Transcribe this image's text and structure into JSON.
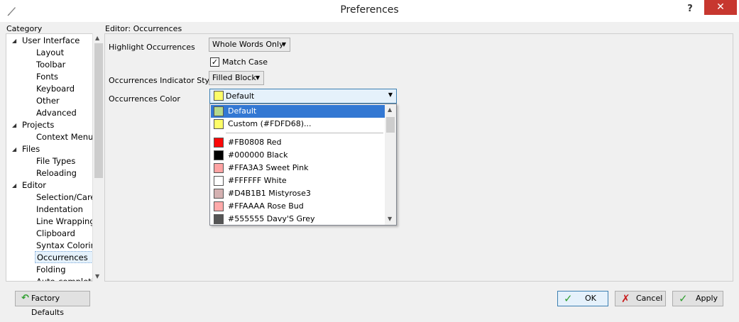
{
  "window": {
    "title": "Preferences",
    "help": "?",
    "close": "✕"
  },
  "sidebar": {
    "header": "Category",
    "items": [
      {
        "label": "User Interface",
        "expanded": true
      },
      {
        "label": "Layout"
      },
      {
        "label": "Toolbar"
      },
      {
        "label": "Fonts"
      },
      {
        "label": "Keyboard"
      },
      {
        "label": "Other"
      },
      {
        "label": "Advanced"
      },
      {
        "label": "Projects",
        "expanded": true
      },
      {
        "label": "Context Menu"
      },
      {
        "label": "Files",
        "expanded": true
      },
      {
        "label": "File Types"
      },
      {
        "label": "Reloading"
      },
      {
        "label": "Editor",
        "expanded": true
      },
      {
        "label": "Selection/Caret"
      },
      {
        "label": "Indentation"
      },
      {
        "label": "Line Wrapping"
      },
      {
        "label": "Clipboard"
      },
      {
        "label": "Syntax Coloring"
      },
      {
        "label": "Occurrences",
        "selected": true
      },
      {
        "label": "Folding"
      },
      {
        "label": "Auto-completion"
      }
    ]
  },
  "panel": {
    "title": "Editor: Occurrences",
    "highlight_label": "Highlight Occurrences",
    "highlight_value": "Whole Words Only",
    "match_case_label": "Match Case",
    "match_case_checked": true,
    "indicator_label": "Occurrences Indicator Style",
    "indicator_value": "Filled Block",
    "color_label": "Occurrences Color",
    "color_value": "Default",
    "color_value_swatch": "#FDFD68"
  },
  "dropdown": {
    "items": [
      {
        "label": "Default",
        "color": "#B5D98B",
        "highlighted": true
      },
      {
        "label": "Custom (#FDFD68)...",
        "color": "#FDFD68"
      },
      {
        "label": "#FB0808 Red",
        "color": "#FB0808"
      },
      {
        "label": "#000000 Black",
        "color": "#000000"
      },
      {
        "label": "#FFA3A3 Sweet Pink",
        "color": "#FFA3A3"
      },
      {
        "label": "#FFFFFF White",
        "color": "#FFFFFF"
      },
      {
        "label": "#D4B1B1 Mistyrose3",
        "color": "#D4B1B1"
      },
      {
        "label": "#FFAAAA Rose Bud",
        "color": "#FFAAAA"
      },
      {
        "label": "#555555 Davy'S Grey",
        "color": "#555555"
      }
    ]
  },
  "footer": {
    "factory_defaults": "Factory Defaults",
    "ok": "OK",
    "cancel": "Cancel",
    "apply": "Apply"
  },
  "colors": {
    "accent": "#3378D3",
    "close_red": "#C7372F",
    "ok_green": "#2E9E2E",
    "cancel_red": "#C81E1E"
  }
}
